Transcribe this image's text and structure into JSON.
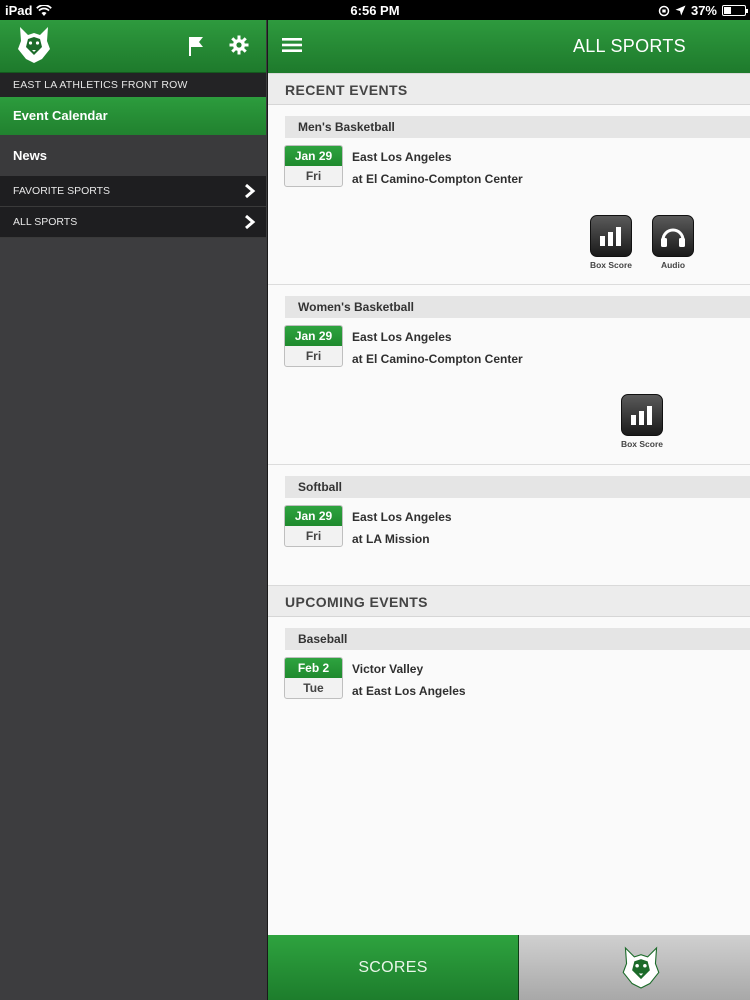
{
  "statusbar": {
    "device": "iPad",
    "time": "6:56 PM",
    "battery": "37%",
    "battery_level": 0.37
  },
  "sidebar": {
    "section_title": "EAST LA ATHLETICS FRONT ROW",
    "items": [
      {
        "label": "Event Calendar"
      },
      {
        "label": "News"
      },
      {
        "label": "FAVORITE SPORTS"
      },
      {
        "label": "ALL SPORTS"
      }
    ]
  },
  "header": {
    "title": "ALL SPORTS"
  },
  "recent": {
    "title": "RECENT EVENTS",
    "events": [
      {
        "sport": "Men's Basketball",
        "date": "Jan 29",
        "day": "Fri",
        "team": "East Los Angeles",
        "location": "at El Camino-Compton Center",
        "box_score": "Box Score",
        "audio": "Audio"
      },
      {
        "sport": "Women's Basketball",
        "date": "Jan 29",
        "day": "Fri",
        "team": "East Los Angeles",
        "location": "at El Camino-Compton Center",
        "box_score": "Box Score"
      },
      {
        "sport": "Softball",
        "date": "Jan 29",
        "day": "Fri",
        "team": "East Los Angeles",
        "location": "at LA Mission"
      }
    ]
  },
  "upcoming": {
    "title": "UPCOMING EVENTS",
    "events": [
      {
        "sport": "Baseball",
        "date": "Feb 2",
        "day": "Tue",
        "team": "Victor Valley",
        "location": "at East Los Angeles"
      }
    ]
  },
  "tabs": {
    "scores": "SCORES"
  },
  "colors": {
    "accent_green": "#2e9a3e",
    "sidebar_bg": "#3d3d3f",
    "sidebar_dark": "#1e1e20"
  },
  "icons": [
    "wifi-icon",
    "location-arrow-icon",
    "husky-logo",
    "flag-icon",
    "gear-icon",
    "menu-icon",
    "chevron-right-icon",
    "box-score-icon",
    "audio-headphones-icon"
  ]
}
